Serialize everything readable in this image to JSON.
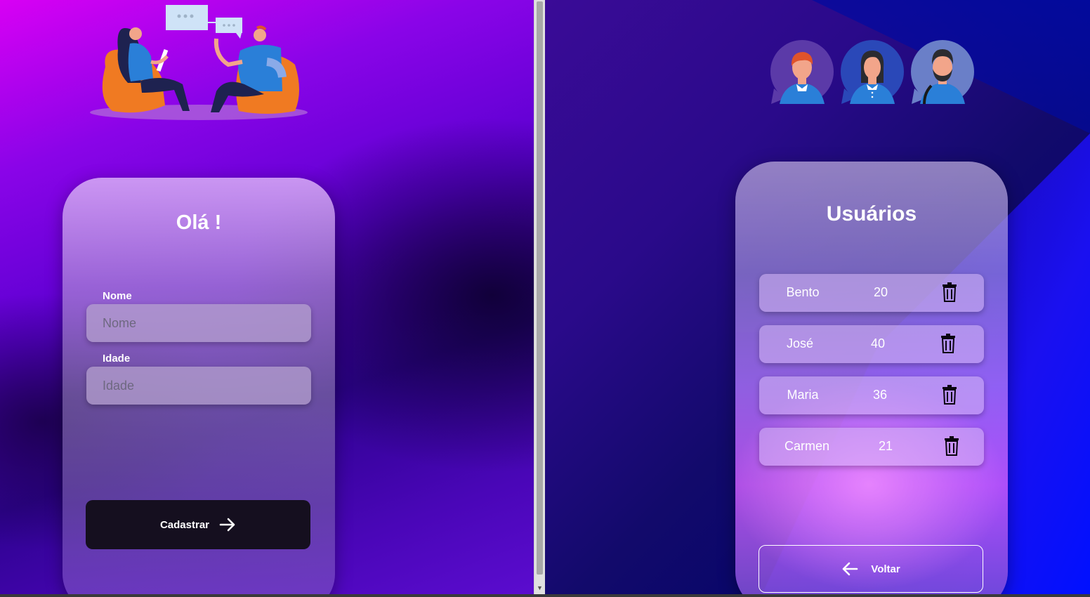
{
  "register": {
    "title": "Olá !",
    "name_label": "Nome",
    "name_placeholder": "Nome",
    "age_label": "Idade",
    "age_placeholder": "Idade",
    "submit_label": "Cadastrar",
    "submit_icon": "arrow-right-icon"
  },
  "users": {
    "title": "Usuários",
    "list": [
      {
        "name": "Bento",
        "age": "20"
      },
      {
        "name": "José",
        "age": "40"
      },
      {
        "name": "Maria",
        "age": "36"
      },
      {
        "name": "Carmen",
        "age": "21"
      }
    ],
    "delete_icon": "trash-icon",
    "back_label": "Voltar",
    "back_icon": "arrow-left-icon"
  },
  "colors": {
    "left_bg_start": "#d800f4",
    "right_bg": "#120a6b",
    "button_dark": "#150f1f"
  }
}
